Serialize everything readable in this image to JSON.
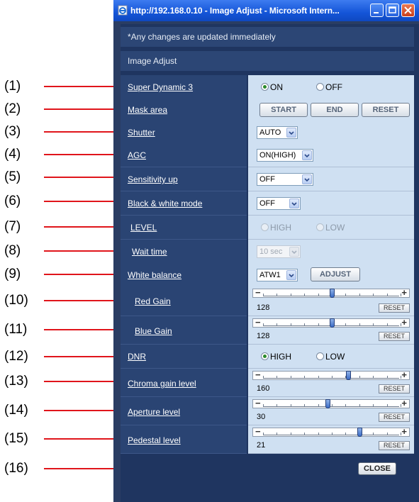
{
  "callouts": [
    "(1)",
    "(2)",
    "(3)",
    "(4)",
    "(5)",
    "(6)",
    "(7)",
    "(8)",
    "(9)",
    "(10)",
    "(11)",
    "(12)",
    "(13)",
    "(14)",
    "(15)",
    "(16)"
  ],
  "window": {
    "title": "http://192.168.0.10 - Image Adjust - Microsoft Intern..."
  },
  "notice": "*Any changes are updated immediately",
  "section_title": "Image Adjust",
  "super_dynamic": {
    "label": "Super Dynamic 3",
    "on": "ON",
    "off": "OFF",
    "selected": "ON"
  },
  "mask_area": {
    "label": "Mask area",
    "start": "START",
    "end": "END",
    "reset": "RESET"
  },
  "shutter": {
    "label": "Shutter",
    "value": "AUTO"
  },
  "agc": {
    "label": "AGC",
    "value": "ON(HIGH)"
  },
  "sensitivity": {
    "label": "Sensitivity up",
    "value": "OFF"
  },
  "bw_mode": {
    "label": "Black & white mode",
    "value": "OFF"
  },
  "level": {
    "label": "LEVEL",
    "high": "HIGH",
    "low": "LOW",
    "selected": "HIGH",
    "disabled": true
  },
  "wait_time": {
    "label": "Wait time",
    "value": "10 sec",
    "disabled": true
  },
  "white_balance": {
    "label": "White balance",
    "value": "ATW1",
    "adjust": "ADJUST"
  },
  "red_gain": {
    "label": "Red Gain",
    "value": "128",
    "position": 0.5,
    "reset": "RESET"
  },
  "blue_gain": {
    "label": "Blue Gain",
    "value": "128",
    "position": 0.5,
    "reset": "RESET"
  },
  "dnr": {
    "label": "DNR",
    "high": "HIGH",
    "low": "LOW",
    "selected": "HIGH"
  },
  "chroma": {
    "label": "Chroma gain level",
    "value": "160",
    "position": 0.62,
    "reset": "RESET"
  },
  "aperture": {
    "label": "Aperture level",
    "value": "30",
    "position": 0.47,
    "reset": "RESET"
  },
  "pedestal": {
    "label": "Pedestal level",
    "value": "21",
    "position": 0.7,
    "reset": "RESET"
  },
  "close": "CLOSE",
  "colors": {
    "leader": "#e0151b",
    "panel": "#1f3560",
    "value_cell": "#cfe0f2"
  }
}
